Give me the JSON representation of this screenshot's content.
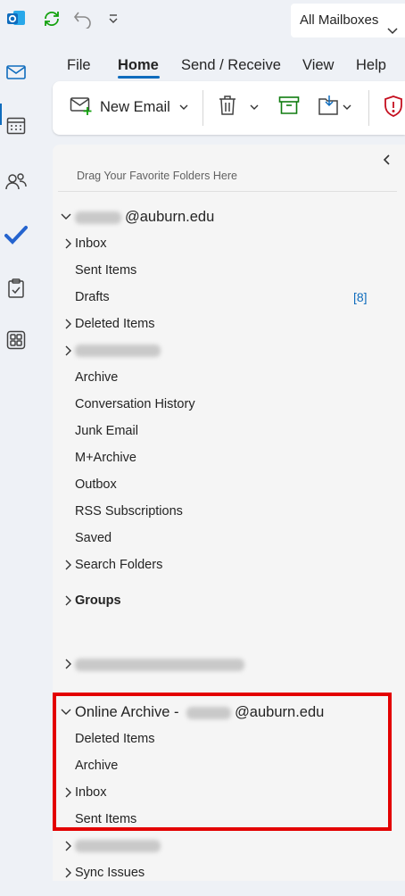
{
  "titlebar": {
    "mailbox_selector": "All Mailboxes",
    "icons": [
      "outlook-logo-icon",
      "sync-icon",
      "undo-icon",
      "customize-qat-icon"
    ]
  },
  "rail": {
    "items": [
      "mail-icon",
      "calendar-icon",
      "people-icon",
      "todo-icon",
      "tasks-icon",
      "apps-icon"
    ],
    "active": "mail"
  },
  "ribbon": {
    "tabs": [
      "File",
      "Home",
      "Send / Receive",
      "View",
      "Help"
    ],
    "active_tab": "Home",
    "new_email_label": "New Email"
  },
  "folder_pane": {
    "favorites_hint": "Drag Your Favorite Folders Here",
    "account_suffix": "@auburn.edu",
    "folders": [
      {
        "label": "Inbox",
        "expandable": true
      },
      {
        "label": "Sent Items",
        "expandable": false
      },
      {
        "label": "Drafts",
        "expandable": false,
        "count": "[8]"
      },
      {
        "label": "Deleted Items",
        "expandable": true
      },
      {
        "label": "",
        "expandable": true,
        "redacted": true
      },
      {
        "label": "Archive",
        "expandable": false
      },
      {
        "label": "Conversation History",
        "expandable": false
      },
      {
        "label": "Junk Email",
        "expandable": false
      },
      {
        "label": "M+Archive",
        "expandable": false
      },
      {
        "label": "Outbox",
        "expandable": false
      },
      {
        "label": "RSS Subscriptions",
        "expandable": false
      },
      {
        "label": "Saved",
        "expandable": false
      },
      {
        "label": "Search Folders",
        "expandable": true
      }
    ],
    "groups_label": "Groups",
    "online_archive": {
      "prefix": "Online Archive - ",
      "suffix": "@auburn.edu",
      "folders": [
        {
          "label": "Deleted Items",
          "expandable": false
        },
        {
          "label": "Archive",
          "expandable": false
        },
        {
          "label": "Inbox",
          "expandable": true
        },
        {
          "label": "Sent Items",
          "expandable": false
        }
      ]
    },
    "trailing_folders": [
      {
        "label": "",
        "expandable": true,
        "redacted": true
      },
      {
        "label": "Sync Issues",
        "expandable": true
      }
    ]
  },
  "colors": {
    "accent": "#0f6cbd",
    "highlight": "#e30000",
    "pane_bg": "#f5f5f5"
  }
}
